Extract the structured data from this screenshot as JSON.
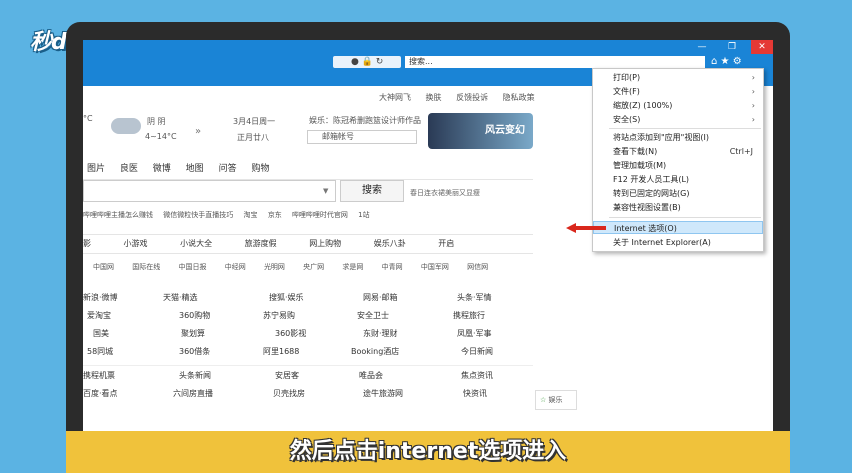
{
  "logo": "秒dōng视频",
  "browser": {
    "search_placeholder": "搜索...",
    "window_controls": [
      "—",
      "❐",
      "✕"
    ]
  },
  "page": {
    "top_links": [
      "大神网飞",
      "换肤",
      "反馈投诉",
      "隐私政策"
    ],
    "weather": {
      "temp_c": "°C",
      "condition": "阴 阴",
      "range": "4~14°C",
      "date": "3月4日周一",
      "lunar": "正月廿八"
    },
    "entertainment": "娱乐：陈冠希删跑篮设计师作品",
    "mail_label": "邮箱帐号",
    "banner_text": "风云变幻",
    "nav_tabs": [
      "图片",
      "良医",
      "微博",
      "地图",
      "问答",
      "购物"
    ],
    "search_button": "搜索",
    "hot_query": "春日连衣裙美丽又显瘦",
    "hot_links": [
      "哔哩哔哩主播怎么赚钱",
      "微信微粒快手直播技巧",
      "淘宝",
      "京东",
      "哔哩哔哩时代官网",
      "1站"
    ],
    "categories": [
      "影",
      "小游戏",
      "小说大全",
      "旅游度假",
      "网上购物",
      "娱乐八卦",
      "开启"
    ],
    "media": [
      "中国网",
      "国际在线",
      "中国日报",
      "中经网",
      "光明网",
      "央广网",
      "求是网",
      "中青网",
      "中国军网",
      "网信网"
    ],
    "grid": [
      [
        "新浪·微博",
        "天猫·精选",
        "搜狐·娱乐",
        "网易·邮箱",
        "头条·军情"
      ],
      [
        "爱淘宝",
        "360购物",
        "苏宁易购",
        "安全卫士",
        "携程旅行"
      ],
      [
        "国美",
        "聚划算",
        "360影视",
        "东财·理财",
        "凤凰·军事"
      ],
      [
        "58同城",
        "360借条",
        "阿里1688",
        "Booking酒店",
        "今日新闻"
      ],
      [
        "携程机票",
        "头条新闻",
        "安居客",
        "唯品会",
        "焦点资讯"
      ],
      [
        "百度·看点",
        "六间房直播",
        "贝壳找房",
        "途牛旅游网",
        "快资讯"
      ]
    ],
    "ent_widget": "娱乐"
  },
  "menu": {
    "items": [
      {
        "label": "打印(P)",
        "arrow": "›"
      },
      {
        "label": "文件(F)",
        "arrow": "›"
      },
      {
        "label": "缩放(Z) (100%)",
        "arrow": "›"
      },
      {
        "label": "安全(S)",
        "arrow": "›"
      },
      {
        "label": "将站点添加到\"应用\"视图(I)"
      },
      {
        "label": "查看下载(N)",
        "shortcut": "Ctrl+J"
      },
      {
        "label": "管理加载项(M)"
      },
      {
        "label": "F12 开发人员工具(L)"
      },
      {
        "label": "转到已固定的网站(G)"
      },
      {
        "label": "兼容性视图设置(B)"
      },
      {
        "label": "Internet 选项(O)"
      },
      {
        "label": "关于 Internet Explorer(A)"
      }
    ]
  },
  "caption": "然后点击internet选项进入"
}
